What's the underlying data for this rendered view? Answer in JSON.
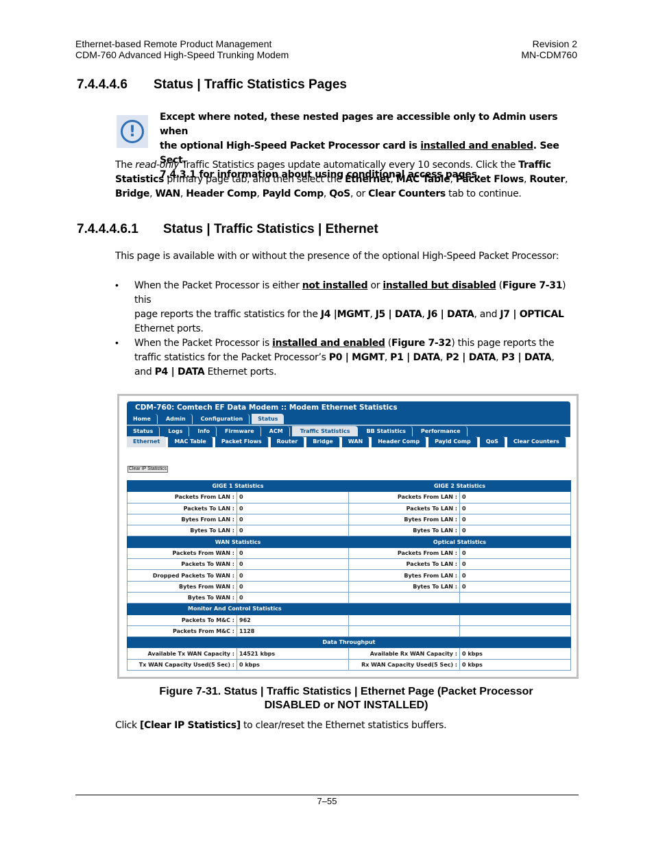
{
  "header": {
    "left_line1": "Ethernet-based Remote Product Management",
    "left_line2": "CDM-760 Advanced High-Speed Trunking Modem",
    "right_line1": "Revision 2",
    "right_line2": "MN-CDM760"
  },
  "section1": {
    "number": "7.4.4.4.6",
    "title": "Status | Traffic Statistics Pages"
  },
  "note": {
    "icon": "important-notice-icon",
    "line1": "Except where noted, these nested pages are accessible only to Admin users when",
    "line2_a": "the optional High-Speed Packet Processor card is ",
    "line2_u": "installed and enabled",
    "line2_b": ". See Sect.",
    "line3": "7.4.3.1 for information about using conditional access pages."
  },
  "intro": {
    "p1": "The ",
    "p1_em": "read-only",
    "p2": " Traffic Statistics pages update automatically every 10 seconds. Click the ",
    "p2_b": "Traffic",
    "p3_b": "Statistics",
    "p3": " primary page tab, and then select the ",
    "tabs_bold": [
      "Ethernet",
      "MAC Table",
      "Packet Flows",
      "Router",
      "Bridge",
      "WAN",
      "Header Comp",
      "Payld Comp",
      "QoS",
      "Clear Counters"
    ],
    "sep": ", ",
    "or": ", or ",
    "end": " tab to continue."
  },
  "section2": {
    "number": "7.4.4.4.6.1",
    "title": "Status | Traffic Statistics | Ethernet"
  },
  "availability": "This page is available with or without the presence of the optional High-Speed Packet Processor:",
  "bullets": [
    {
      "l1_a": "When the Packet Processor is either ",
      "l1_u1": "not installed",
      "l1_b": " or ",
      "l1_u2": "installed but disabled",
      "l1_c": " (",
      "l1_fig": "Figure 7-31",
      "l1_d": ") this",
      "l2_a": "page reports the traffic statistics for the ",
      "l2_p1": "J4 |MGMT",
      "l2_p2": "J5 | DATA",
      "l2_p3": "J6 | DATA",
      "l2_and": ", and ",
      "l2_p4": "J7 | OPTICAL",
      "l3": "Ethernet ports."
    },
    {
      "l1_a": "When the Packet Processor is ",
      "l1_u1": "installed and enabled",
      "l1_c": " (",
      "l1_fig": "Figure 7-32",
      "l1_d": ") this page reports the",
      "l2_a": "traffic statistics for the Packet Processor’s ",
      "l2_p1": "P0 | MGMT",
      "l2_p2": "P1 | DATA",
      "l2_p3": "P2 | DATA",
      "l2_p4": "P3 | DATA",
      "l3_a": "and ",
      "l3_p5": "P4 | DATA",
      "l3_b": " Ethernet ports."
    }
  ],
  "figure": {
    "title": "CDM-760: Comtech EF Data Modem :: Modem Ethernet Statistics",
    "nav_primary": [
      {
        "label": "Home",
        "active": false
      },
      {
        "label": "Admin",
        "active": false
      },
      {
        "label": "Configuration",
        "active": false
      },
      {
        "label": "Status",
        "active": true
      }
    ],
    "nav_secondary": [
      {
        "label": "Status",
        "active": false
      },
      {
        "label": "Logs",
        "active": false
      },
      {
        "label": "Info",
        "active": false
      },
      {
        "label": "Firmware",
        "active": false
      },
      {
        "label": "ACM",
        "active": false
      },
      {
        "label": "Traffic Statistics",
        "active": true
      },
      {
        "label": "BB Statistics",
        "active": false
      },
      {
        "label": "Performance",
        "active": false
      }
    ],
    "nav_tertiary": [
      {
        "label": "Ethernet",
        "active": true
      },
      {
        "label": "MAC Table",
        "active": false
      },
      {
        "label": "Packet Flows",
        "active": false
      },
      {
        "label": "Router",
        "active": false
      },
      {
        "label": "Bridge",
        "active": false
      },
      {
        "label": "WAN",
        "active": false
      },
      {
        "label": "Header Comp",
        "active": false
      },
      {
        "label": "Payld Comp",
        "active": false
      },
      {
        "label": "QoS",
        "active": false
      },
      {
        "label": "Clear Counters",
        "active": false
      }
    ],
    "clear_button": "Clear IP Statistics",
    "sections": {
      "gige1": "GIGE 1 Statistics",
      "gige2": "GIGE 2 Statistics",
      "wan": "WAN Statistics",
      "optical": "Optical Statistics",
      "mc": "Monitor And Control Statistics",
      "throughput": "Data Throughput"
    },
    "gige1": [
      {
        "label": "Packets From LAN :",
        "value": "0"
      },
      {
        "label": "Packets To LAN :",
        "value": "0"
      },
      {
        "label": "Bytes From LAN :",
        "value": "0"
      },
      {
        "label": "Bytes To LAN :",
        "value": "0"
      }
    ],
    "gige2": [
      {
        "label": "Packets From LAN :",
        "value": "0"
      },
      {
        "label": "Packets To LAN :",
        "value": "0"
      },
      {
        "label": "Bytes From LAN :",
        "value": "0"
      },
      {
        "label": "Bytes To LAN :",
        "value": "0"
      }
    ],
    "wan": [
      {
        "label": "Packets From WAN :",
        "value": "0"
      },
      {
        "label": "Packets To WAN :",
        "value": "0"
      },
      {
        "label": "Dropped Packets To WAN :",
        "value": "0"
      },
      {
        "label": "Bytes From WAN :",
        "value": "0"
      },
      {
        "label": "Bytes To WAN :",
        "value": "0"
      }
    ],
    "optical": [
      {
        "label": "Packets From LAN :",
        "value": "0"
      },
      {
        "label": "Packets To LAN :",
        "value": "0"
      },
      {
        "label": "Bytes From LAN :",
        "value": "0"
      },
      {
        "label": "Bytes To LAN :",
        "value": "0"
      }
    ],
    "mc": [
      {
        "label": "Packets To M&C :",
        "value": "962"
      },
      {
        "label": "Packets From M&C :",
        "value": "1128"
      }
    ],
    "throughput": [
      {
        "label": "Available Tx WAN Capacity :",
        "value": "14521 kbps",
        "label2": "Available Rx WAN Capacity :",
        "value2": "0 kbps"
      },
      {
        "label": "Tx WAN Capacity Used(5 Sec) :",
        "value": "0 kbps",
        "label2": "Rx WAN Capacity Used(5 Sec) :",
        "value2": "0 kbps"
      }
    ]
  },
  "caption": {
    "line1": "Figure 7-31. Status | Traffic Statistics | Ethernet Page (Packet Processor",
    "line2": "DISABLED or NOT INSTALLED)"
  },
  "clear_text": {
    "a": "Click ",
    "b": "[Clear IP Statistics]",
    "c": " to clear/reset the Ethernet statistics buffers."
  },
  "page_number": "7–55",
  "colors": {
    "nav_blue": "#0a5493",
    "active_tab": "#dde3e8",
    "note_icon_blue": "#2f6fb5",
    "figure_border": "#c0c0c0"
  }
}
